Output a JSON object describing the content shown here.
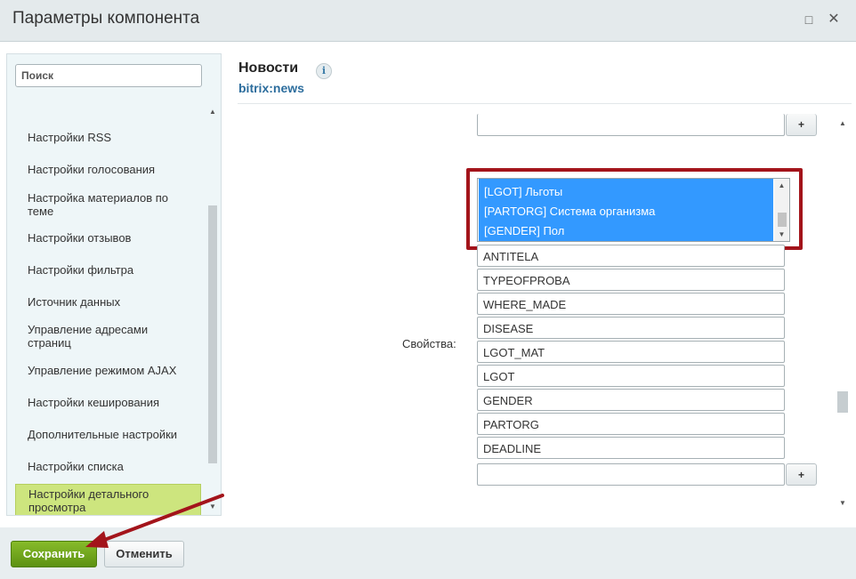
{
  "window": {
    "title": "Параметры компонента"
  },
  "sidebar": {
    "search_placeholder": "Поиск",
    "items": [
      {
        "label": "Настройки RSS"
      },
      {
        "label": "Настройки голосования"
      },
      {
        "label": "Настройка материалов по теме"
      },
      {
        "label": "Настройки отзывов"
      },
      {
        "label": "Настройки фильтра"
      },
      {
        "label": "Источник данных"
      },
      {
        "label": "Управление адресами страниц"
      },
      {
        "label": "Управление режимом AJAX"
      },
      {
        "label": "Настройки кеширования"
      },
      {
        "label": "Дополнительные настройки"
      },
      {
        "label": "Настройки списка"
      },
      {
        "label": "Настройки детального просмотра",
        "active": true
      }
    ]
  },
  "component": {
    "title": "Новости",
    "id": "bitrix:news"
  },
  "properties": {
    "label": "Свойства:",
    "selected_options": [
      "[LGOT] Льготы",
      "[PARTORG] Система организма",
      "[GENDER] Пол"
    ],
    "fields": [
      "ANTITELA",
      "TYPEOFPROBA",
      "WHERE_MADE",
      "DISEASE",
      "LGOT_MAT",
      "LGOT",
      "GENDER",
      "PARTORG",
      "DEADLINE"
    ],
    "add_label": "+"
  },
  "footer": {
    "save_label": "Сохранить",
    "cancel_label": "Отменить"
  },
  "colors": {
    "highlight_frame": "#a3141b",
    "selection": "#3399ff",
    "save_button": "#6fa41c",
    "active_item": "#cde57e"
  }
}
